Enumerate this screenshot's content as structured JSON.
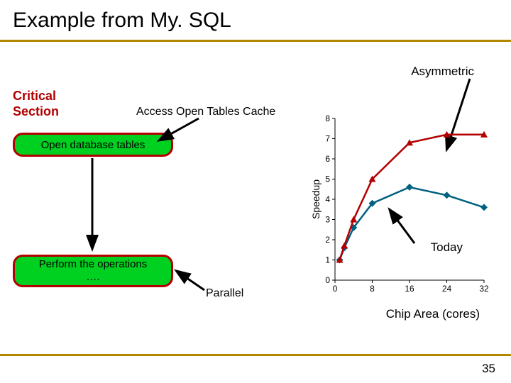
{
  "title": "Example from My. SQL",
  "asymmetric_label": "Asymmetric",
  "critical_section_label_line1": "Critical",
  "critical_section_label_line2": "Section",
  "access_label": "Access Open Tables Cache",
  "box1_label": "Open database tables",
  "box2_label_line1": "Perform the operations",
  "box2_label_line2": "….",
  "parallel_label": "Parallel",
  "today_label": "Today",
  "xaxis_label": "Chip Area (cores)",
  "page_number": "35",
  "chart_data": {
    "type": "line",
    "xlabel": "Chip Area (cores)",
    "ylabel": "Speedup",
    "ylim": [
      0,
      8
    ],
    "xlim": [
      0,
      32
    ],
    "xticks": [
      0,
      8,
      16,
      24,
      32
    ],
    "yticks": [
      0,
      1,
      2,
      3,
      4,
      5,
      6,
      7,
      8
    ],
    "series": [
      {
        "name": "Today",
        "color": "#006080",
        "marker": "diamond",
        "x": [
          1,
          2,
          4,
          8,
          16,
          24,
          32
        ],
        "y": [
          1.0,
          1.6,
          2.6,
          3.8,
          4.6,
          4.2,
          3.6
        ]
      },
      {
        "name": "Asymmetric",
        "color": "#b30000",
        "marker": "triangle",
        "x": [
          1,
          2,
          4,
          8,
          16,
          24,
          32
        ],
        "y": [
          1.0,
          1.7,
          3.0,
          5.0,
          6.8,
          7.2,
          7.2
        ]
      }
    ],
    "today_arrow_at_x": 16
  }
}
